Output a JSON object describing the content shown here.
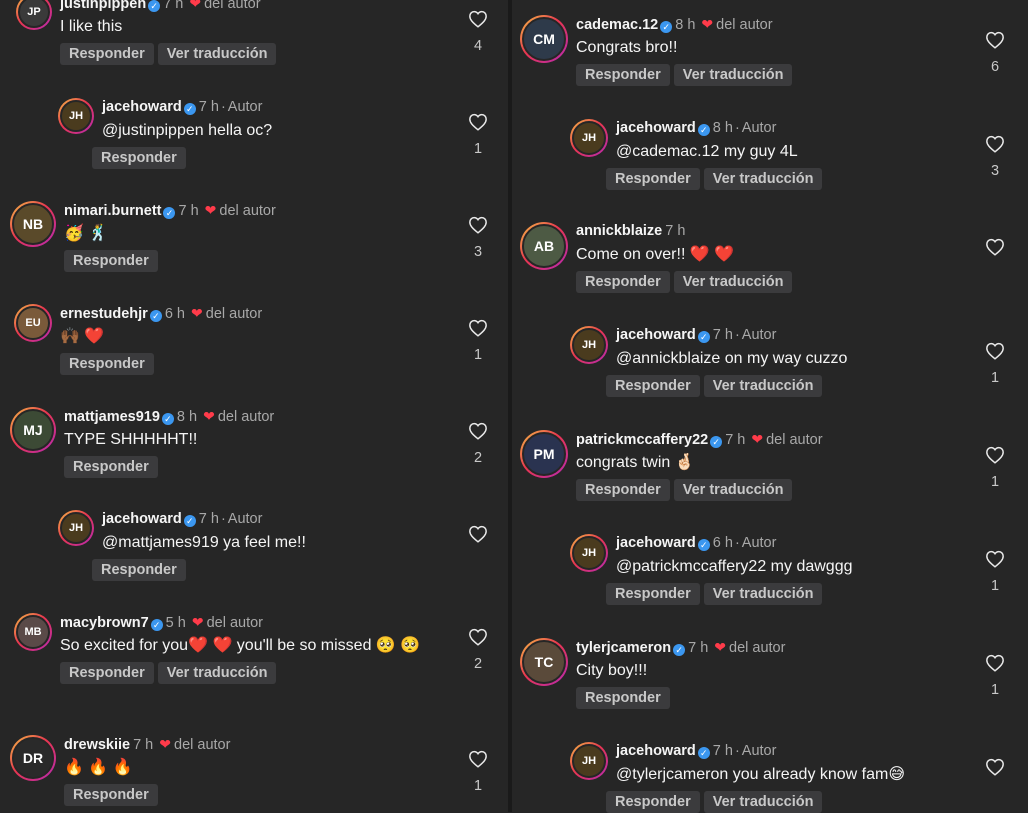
{
  "colors": {
    "bg": "#262626",
    "verified": "#3b97f0",
    "heart": "#ff3b4a",
    "button": "#3b3b3d"
  },
  "left": [
    {
      "id": "c1",
      "user": "justinpippen",
      "verified": true,
      "time": "7 h",
      "liked": true,
      "liked_label": "del autor",
      "text": "I like this",
      "buttons": [
        "Responder",
        "Ver traducción"
      ],
      "likes": "4",
      "avatar": "JP",
      "avatar_icon": "profile-photo"
    },
    {
      "id": "c2",
      "user": "jacehoward",
      "verified": true,
      "time": "7 h",
      "author": "Autor",
      "text": "@justinpippen hella oc?",
      "buttons": [
        "Responder"
      ],
      "likes": "1",
      "avatar": "JH"
    },
    {
      "id": "c3",
      "user": "nimari.burnett",
      "verified": true,
      "time": "7 h",
      "liked": true,
      "liked_label": "del autor",
      "text": "🥳 🕺",
      "buttons": [
        "Responder"
      ],
      "likes": "3",
      "avatar": "NB"
    },
    {
      "id": "c4",
      "user": "ernestudehjr",
      "verified": true,
      "time": "6 h",
      "liked": true,
      "liked_label": "del autor",
      "text": "🙌🏾 ❤️",
      "buttons": [
        "Responder"
      ],
      "likes": "1",
      "avatar": "EU"
    },
    {
      "id": "c5",
      "user": "mattjames919",
      "verified": true,
      "time": "8 h",
      "liked": true,
      "liked_label": "del autor",
      "text": "TYPE SHHHHHT!!",
      "buttons": [
        "Responder"
      ],
      "likes": "2",
      "avatar": "MJ"
    },
    {
      "id": "c6",
      "user": "jacehoward",
      "verified": true,
      "time": "7 h",
      "author": "Autor",
      "text": "@mattjames919 ya feel me!!",
      "buttons": [
        "Responder"
      ],
      "likes": "",
      "avatar": "JH"
    },
    {
      "id": "c7",
      "user": "macybrown7",
      "verified": true,
      "time": "5 h",
      "liked": true,
      "liked_label": "del autor",
      "text": "So excited for you❤️ ❤️  you'll be so missed 🥺 🥺",
      "buttons": [
        "Responder",
        "Ver traducción"
      ],
      "likes": "2",
      "avatar": "MB"
    },
    {
      "id": "c8",
      "user": "drewskiie",
      "verified": false,
      "time": "7 h",
      "liked": true,
      "liked_label": "del autor",
      "text": "🔥 🔥 🔥",
      "buttons": [
        "Responder"
      ],
      "likes": "1",
      "avatar": "DR"
    }
  ],
  "right": [
    {
      "id": "r1",
      "user": "cademac.12",
      "verified": true,
      "time": "8 h",
      "liked": true,
      "liked_label": "del autor",
      "text": "Congrats bro!!",
      "buttons": [
        "Responder",
        "Ver traducción"
      ],
      "likes": "6",
      "avatar": "CM"
    },
    {
      "id": "r2",
      "user": "jacehoward",
      "verified": true,
      "time": "8 h",
      "author": "Autor",
      "text": "@cademac.12 my guy 4L",
      "buttons": [
        "Responder",
        "Ver traducción"
      ],
      "likes": "3",
      "avatar": "JH"
    },
    {
      "id": "r3",
      "user": "annickblaize",
      "verified": false,
      "time": "7 h",
      "liked": false,
      "text": "Come on over!! ❤️ ❤️",
      "buttons": [
        "Responder",
        "Ver traducción"
      ],
      "likes": "",
      "avatar": "AB"
    },
    {
      "id": "r4",
      "user": "jacehoward",
      "verified": true,
      "time": "7 h",
      "author": "Autor",
      "text": "@annickblaize on my way cuzzo",
      "buttons": [
        "Responder",
        "Ver traducción"
      ],
      "likes": "1",
      "avatar": "JH"
    },
    {
      "id": "r5",
      "user": "patrickmccaffery22",
      "verified": true,
      "time": "7 h",
      "liked": true,
      "liked_label": "del autor",
      "text": "congrats twin 🤞🏻",
      "buttons": [
        "Responder",
        "Ver traducción"
      ],
      "likes": "1",
      "avatar": "PM"
    },
    {
      "id": "r6",
      "user": "jacehoward",
      "verified": true,
      "time": "6 h",
      "author": "Autor",
      "text": "@patrickmccaffery22 my dawggg",
      "buttons": [
        "Responder",
        "Ver traducción"
      ],
      "likes": "1",
      "avatar": "JH"
    },
    {
      "id": "r7",
      "user": "tylerjcameron",
      "verified": true,
      "time": "7 h",
      "liked": true,
      "liked_label": "del autor",
      "text": "City boy!!!",
      "buttons": [
        "Responder"
      ],
      "likes": "1",
      "avatar": "TC"
    },
    {
      "id": "r8",
      "user": "jacehoward",
      "verified": true,
      "time": "7 h",
      "author": "Autor",
      "text": "@tylerjcameron you already know fam😅",
      "buttons": [
        "Responder",
        "Ver traducción"
      ],
      "likes": "",
      "avatar": "JH"
    }
  ]
}
